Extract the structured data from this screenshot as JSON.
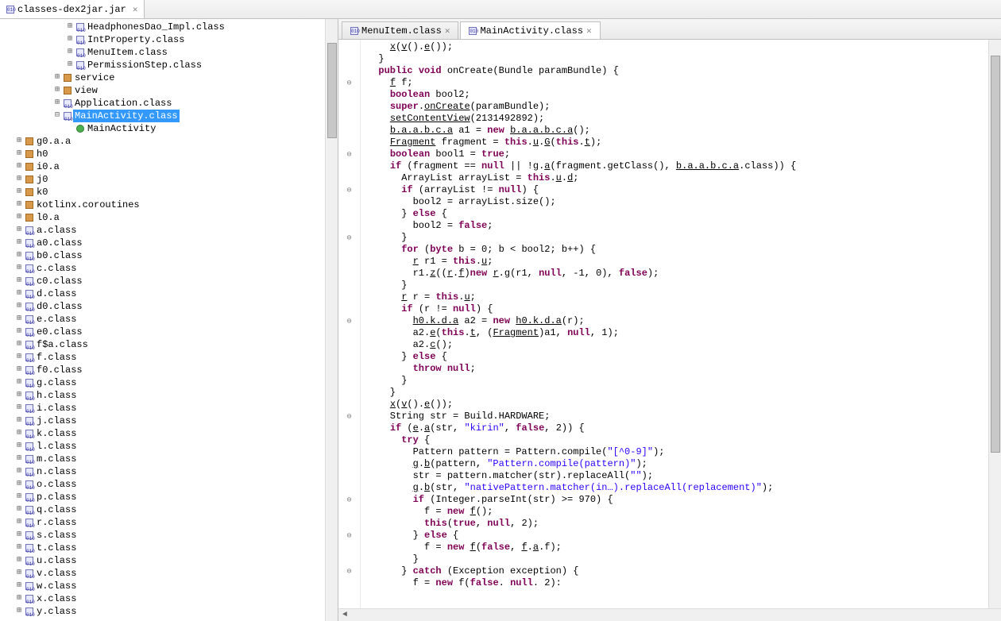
{
  "top_tab": {
    "label": "classes-dex2jar.jar"
  },
  "tree": {
    "items": [
      {
        "indent": 5,
        "tw": "expand",
        "ico": "cls",
        "label": "HeadphonesDao_Impl.class"
      },
      {
        "indent": 5,
        "tw": "expand",
        "ico": "cls",
        "label": "IntProperty.class"
      },
      {
        "indent": 5,
        "tw": "expand",
        "ico": "cls",
        "label": "MenuItem.class"
      },
      {
        "indent": 5,
        "tw": "expand",
        "ico": "cls",
        "label": "PermissionStep.class"
      },
      {
        "indent": 4,
        "tw": "expand",
        "ico": "pkg",
        "label": "service"
      },
      {
        "indent": 4,
        "tw": "expand",
        "ico": "pkg",
        "label": "view"
      },
      {
        "indent": 4,
        "tw": "expand",
        "ico": "cls",
        "label": "Application.class"
      },
      {
        "indent": 4,
        "tw": "collapse",
        "ico": "cls",
        "label": "MainActivity.class",
        "selected": true
      },
      {
        "indent": 5,
        "tw": "none",
        "ico": "green",
        "label": "MainActivity"
      },
      {
        "indent": 1,
        "tw": "expand",
        "ico": "pkg",
        "label": "g0.a.a"
      },
      {
        "indent": 1,
        "tw": "expand",
        "ico": "pkg",
        "label": "h0"
      },
      {
        "indent": 1,
        "tw": "expand",
        "ico": "pkg",
        "label": "i0.a"
      },
      {
        "indent": 1,
        "tw": "expand",
        "ico": "pkg",
        "label": "j0"
      },
      {
        "indent": 1,
        "tw": "expand",
        "ico": "pkg",
        "label": "k0"
      },
      {
        "indent": 1,
        "tw": "expand",
        "ico": "pkg",
        "label": "kotlinx.coroutines"
      },
      {
        "indent": 1,
        "tw": "expand",
        "ico": "pkg",
        "label": "l0.a"
      },
      {
        "indent": 1,
        "tw": "expand",
        "ico": "cls",
        "label": "a.class"
      },
      {
        "indent": 1,
        "tw": "expand",
        "ico": "cls",
        "label": "a0.class"
      },
      {
        "indent": 1,
        "tw": "expand",
        "ico": "cls",
        "label": "b0.class"
      },
      {
        "indent": 1,
        "tw": "expand",
        "ico": "cls",
        "label": "c.class"
      },
      {
        "indent": 1,
        "tw": "expand",
        "ico": "cls",
        "label": "c0.class"
      },
      {
        "indent": 1,
        "tw": "expand",
        "ico": "cls",
        "label": "d.class"
      },
      {
        "indent": 1,
        "tw": "expand",
        "ico": "cls",
        "label": "d0.class"
      },
      {
        "indent": 1,
        "tw": "expand",
        "ico": "cls",
        "label": "e.class"
      },
      {
        "indent": 1,
        "tw": "expand",
        "ico": "cls",
        "label": "e0.class"
      },
      {
        "indent": 1,
        "tw": "expand",
        "ico": "cls",
        "label": "f$a.class"
      },
      {
        "indent": 1,
        "tw": "expand",
        "ico": "cls",
        "label": "f.class"
      },
      {
        "indent": 1,
        "tw": "expand",
        "ico": "cls",
        "label": "f0.class"
      },
      {
        "indent": 1,
        "tw": "expand",
        "ico": "cls",
        "label": "g.class"
      },
      {
        "indent": 1,
        "tw": "expand",
        "ico": "cls",
        "label": "h.class"
      },
      {
        "indent": 1,
        "tw": "expand",
        "ico": "cls",
        "label": "i.class"
      },
      {
        "indent": 1,
        "tw": "expand",
        "ico": "cls",
        "label": "j.class"
      },
      {
        "indent": 1,
        "tw": "expand",
        "ico": "cls",
        "label": "k.class"
      },
      {
        "indent": 1,
        "tw": "expand",
        "ico": "cls",
        "label": "l.class"
      },
      {
        "indent": 1,
        "tw": "expand",
        "ico": "cls",
        "label": "m.class"
      },
      {
        "indent": 1,
        "tw": "expand",
        "ico": "cls",
        "label": "n.class"
      },
      {
        "indent": 1,
        "tw": "expand",
        "ico": "cls",
        "label": "o.class"
      },
      {
        "indent": 1,
        "tw": "expand",
        "ico": "cls",
        "label": "p.class"
      },
      {
        "indent": 1,
        "tw": "expand",
        "ico": "cls",
        "label": "q.class"
      },
      {
        "indent": 1,
        "tw": "expand",
        "ico": "cls",
        "label": "r.class"
      },
      {
        "indent": 1,
        "tw": "expand",
        "ico": "cls",
        "label": "s.class"
      },
      {
        "indent": 1,
        "tw": "expand",
        "ico": "cls",
        "label": "t.class"
      },
      {
        "indent": 1,
        "tw": "expand",
        "ico": "cls",
        "label": "u.class"
      },
      {
        "indent": 1,
        "tw": "expand",
        "ico": "cls",
        "label": "v.class"
      },
      {
        "indent": 1,
        "tw": "expand",
        "ico": "cls",
        "label": "w.class"
      },
      {
        "indent": 1,
        "tw": "expand",
        "ico": "cls",
        "label": "x.class"
      },
      {
        "indent": 1,
        "tw": "expand",
        "ico": "cls",
        "label": "y.class"
      }
    ]
  },
  "editor_tabs": [
    {
      "label": "MenuItem.class",
      "active": false
    },
    {
      "label": "MainActivity.class",
      "active": true
    }
  ],
  "fold_markers": [
    3,
    9,
    12,
    16,
    23,
    31,
    38,
    41,
    44,
    47
  ],
  "code_lines": [
    [
      [
        "",
        "    "
      ],
      [
        "u",
        "x"
      ],
      [
        "",
        "("
      ],
      [
        "u",
        "v"
      ],
      [
        "",
        "()."
      ],
      [
        "u",
        "e"
      ],
      [
        "",
        "());"
      ]
    ],
    [
      [
        "",
        "  }"
      ]
    ],
    [
      [
        "",
        ""
      ]
    ],
    [
      [
        "",
        "  "
      ],
      [
        "kw",
        "public void"
      ],
      [
        "",
        " onCreate(Bundle paramBundle) {"
      ]
    ],
    [
      [
        "",
        "    "
      ],
      [
        "u",
        "f"
      ],
      [
        "",
        " f;"
      ]
    ],
    [
      [
        "",
        "    "
      ],
      [
        "kw",
        "boolean"
      ],
      [
        "",
        " bool2;"
      ]
    ],
    [
      [
        "",
        "    "
      ],
      [
        "kw",
        "super"
      ],
      [
        "",
        "."
      ],
      [
        "u",
        "onCreate"
      ],
      [
        "",
        "(paramBundle);"
      ]
    ],
    [
      [
        "",
        "    "
      ],
      [
        "u",
        "setContentView"
      ],
      [
        "",
        "(2131492892);"
      ]
    ],
    [
      [
        "",
        "    "
      ],
      [
        "u",
        "b.a.a.b.c.a"
      ],
      [
        "",
        " a1 = "
      ],
      [
        "kw",
        "new"
      ],
      [
        "",
        " "
      ],
      [
        "u",
        "b.a.a.b.c.a"
      ],
      [
        "",
        "();"
      ]
    ],
    [
      [
        "",
        "    "
      ],
      [
        "u",
        "Fragment"
      ],
      [
        "",
        " fragment = "
      ],
      [
        "kw",
        "this"
      ],
      [
        "",
        "."
      ],
      [
        "u",
        "u"
      ],
      [
        "",
        "."
      ],
      [
        "u",
        "G"
      ],
      [
        "",
        "("
      ],
      [
        "kw",
        "this"
      ],
      [
        "",
        "."
      ],
      [
        "u",
        "t"
      ],
      [
        "",
        ");"
      ]
    ],
    [
      [
        "",
        "    "
      ],
      [
        "kw",
        "boolean"
      ],
      [
        "",
        " bool1 = "
      ],
      [
        "kw",
        "true"
      ],
      [
        "",
        ";"
      ]
    ],
    [
      [
        "",
        "    "
      ],
      [
        "kw",
        "if"
      ],
      [
        "",
        " (fragment == "
      ],
      [
        "kw",
        "null"
      ],
      [
        "",
        " || !"
      ],
      [
        "u",
        "g"
      ],
      [
        "",
        "."
      ],
      [
        "u",
        "a"
      ],
      [
        "",
        "(fragment.getClass(), "
      ],
      [
        "u",
        "b.a.a.b.c.a"
      ],
      [
        "",
        ".class)) {"
      ]
    ],
    [
      [
        "",
        "      ArrayList arrayList = "
      ],
      [
        "kw",
        "this"
      ],
      [
        "",
        "."
      ],
      [
        "u",
        "u"
      ],
      [
        "",
        "."
      ],
      [
        "u",
        "d"
      ],
      [
        "",
        ";"
      ]
    ],
    [
      [
        "",
        "      "
      ],
      [
        "kw",
        "if"
      ],
      [
        "",
        " (arrayList != "
      ],
      [
        "kw",
        "null"
      ],
      [
        "",
        ") {"
      ]
    ],
    [
      [
        "",
        "        bool2 = arrayList.size();"
      ]
    ],
    [
      [
        "",
        "      } "
      ],
      [
        "kw",
        "else"
      ],
      [
        "",
        " {"
      ]
    ],
    [
      [
        "",
        "        bool2 = "
      ],
      [
        "kw",
        "false"
      ],
      [
        "",
        ";"
      ]
    ],
    [
      [
        "",
        "      }"
      ]
    ],
    [
      [
        "",
        "      "
      ],
      [
        "kw",
        "for"
      ],
      [
        "",
        " ("
      ],
      [
        "kw",
        "byte"
      ],
      [
        "",
        " b = 0; b < bool2; b++) {"
      ]
    ],
    [
      [
        "",
        "        "
      ],
      [
        "u",
        "r"
      ],
      [
        "",
        " r1 = "
      ],
      [
        "kw",
        "this"
      ],
      [
        "",
        "."
      ],
      [
        "u",
        "u"
      ],
      [
        "",
        ";"
      ]
    ],
    [
      [
        "",
        "        r1."
      ],
      [
        "u",
        "z"
      ],
      [
        "",
        "(("
      ],
      [
        "u",
        "r"
      ],
      [
        "",
        "."
      ],
      [
        "u",
        "f"
      ],
      [
        "",
        ")"
      ],
      [
        "kw",
        "new"
      ],
      [
        "",
        " "
      ],
      [
        "u",
        "r"
      ],
      [
        "",
        "."
      ],
      [
        "u",
        "g"
      ],
      [
        "",
        "(r1, "
      ],
      [
        "kw",
        "null"
      ],
      [
        "",
        ", -1, 0), "
      ],
      [
        "kw",
        "false"
      ],
      [
        "",
        ");"
      ]
    ],
    [
      [
        "",
        "      }"
      ]
    ],
    [
      [
        "",
        "      "
      ],
      [
        "u",
        "r"
      ],
      [
        "",
        " r = "
      ],
      [
        "kw",
        "this"
      ],
      [
        "",
        "."
      ],
      [
        "u",
        "u"
      ],
      [
        "",
        ";"
      ]
    ],
    [
      [
        "",
        "      "
      ],
      [
        "kw",
        "if"
      ],
      [
        "",
        " (r != "
      ],
      [
        "kw",
        "null"
      ],
      [
        "",
        ") {"
      ]
    ],
    [
      [
        "",
        "        "
      ],
      [
        "u",
        "h0.k.d.a"
      ],
      [
        "",
        " a2 = "
      ],
      [
        "kw",
        "new"
      ],
      [
        "",
        " "
      ],
      [
        "u",
        "h0.k.d.a"
      ],
      [
        "",
        "(r);"
      ]
    ],
    [
      [
        "",
        "        a2."
      ],
      [
        "u",
        "e"
      ],
      [
        "",
        "("
      ],
      [
        "kw",
        "this"
      ],
      [
        "",
        "."
      ],
      [
        "u",
        "t"
      ],
      [
        "",
        ", ("
      ],
      [
        "u",
        "Fragment"
      ],
      [
        "",
        ")a1, "
      ],
      [
        "kw",
        "null"
      ],
      [
        "",
        ", 1);"
      ]
    ],
    [
      [
        "",
        "        a2."
      ],
      [
        "u",
        "c"
      ],
      [
        "",
        "();"
      ]
    ],
    [
      [
        "",
        "      } "
      ],
      [
        "kw",
        "else"
      ],
      [
        "",
        " {"
      ]
    ],
    [
      [
        "",
        "        "
      ],
      [
        "kw",
        "throw null"
      ],
      [
        "",
        ";"
      ]
    ],
    [
      [
        "",
        "      }"
      ]
    ],
    [
      [
        "",
        "    }"
      ]
    ],
    [
      [
        "",
        "    "
      ],
      [
        "u",
        "x"
      ],
      [
        "",
        "("
      ],
      [
        "u",
        "v"
      ],
      [
        "",
        "()."
      ],
      [
        "u",
        "e"
      ],
      [
        "",
        "());"
      ]
    ],
    [
      [
        "",
        "    String str = Build.HARDWARE;"
      ]
    ],
    [
      [
        "",
        "    "
      ],
      [
        "kw",
        "if"
      ],
      [
        "",
        " ("
      ],
      [
        "u",
        "e"
      ],
      [
        "",
        "."
      ],
      [
        "u",
        "a"
      ],
      [
        "",
        "(str, "
      ],
      [
        "str",
        "\"kirin\""
      ],
      [
        "",
        ", "
      ],
      [
        "kw",
        "false"
      ],
      [
        "",
        ", 2)) {"
      ]
    ],
    [
      [
        "",
        "      "
      ],
      [
        "kw",
        "try"
      ],
      [
        "",
        " {"
      ]
    ],
    [
      [
        "",
        "        Pattern pattern = Pattern.compile("
      ],
      [
        "str",
        "\"[^0-9]\""
      ],
      [
        "",
        ");"
      ]
    ],
    [
      [
        "",
        "        "
      ],
      [
        "u",
        "g"
      ],
      [
        "",
        "."
      ],
      [
        "u",
        "b"
      ],
      [
        "",
        "(pattern, "
      ],
      [
        "str",
        "\"Pattern.compile(pattern)\""
      ],
      [
        "",
        ");"
      ]
    ],
    [
      [
        "",
        "        str = pattern.matcher(str).replaceAll("
      ],
      [
        "str",
        "\"\""
      ],
      [
        "",
        ");"
      ]
    ],
    [
      [
        "",
        "        "
      ],
      [
        "u",
        "g"
      ],
      [
        "",
        "."
      ],
      [
        "u",
        "b"
      ],
      [
        "",
        "(str, "
      ],
      [
        "str",
        "\"nativePattern.matcher(in…).replaceAll(replacement)\""
      ],
      [
        "",
        ");"
      ]
    ],
    [
      [
        "",
        "        "
      ],
      [
        "kw",
        "if"
      ],
      [
        "",
        " (Integer.parseInt(str) >= 970) {"
      ]
    ],
    [
      [
        "",
        "          f = "
      ],
      [
        "kw",
        "new"
      ],
      [
        "",
        " "
      ],
      [
        "u",
        "f"
      ],
      [
        "",
        "();"
      ]
    ],
    [
      [
        "",
        "          "
      ],
      [
        "kw",
        "this"
      ],
      [
        "",
        "("
      ],
      [
        "kw",
        "true"
      ],
      [
        "",
        ", "
      ],
      [
        "kw",
        "null"
      ],
      [
        "",
        ", 2);"
      ]
    ],
    [
      [
        "",
        "        } "
      ],
      [
        "kw",
        "else"
      ],
      [
        "",
        " {"
      ]
    ],
    [
      [
        "",
        "          f = "
      ],
      [
        "kw",
        "new"
      ],
      [
        "",
        " "
      ],
      [
        "u",
        "f"
      ],
      [
        "",
        "("
      ],
      [
        "kw",
        "false"
      ],
      [
        "",
        ", "
      ],
      [
        "u",
        "f"
      ],
      [
        "",
        "."
      ],
      [
        "u",
        "a"
      ],
      [
        "",
        ".f);"
      ]
    ],
    [
      [
        "",
        "        }"
      ]
    ],
    [
      [
        "",
        "      } "
      ],
      [
        "kw",
        "catch"
      ],
      [
        "",
        " (Exception exception) {"
      ]
    ],
    [
      [
        "",
        "        f = "
      ],
      [
        "kw",
        "new"
      ],
      [
        "",
        " f("
      ],
      [
        "kw",
        "false"
      ],
      [
        "",
        ". "
      ],
      [
        "kw",
        "null"
      ],
      [
        "",
        ". 2):"
      ]
    ]
  ]
}
